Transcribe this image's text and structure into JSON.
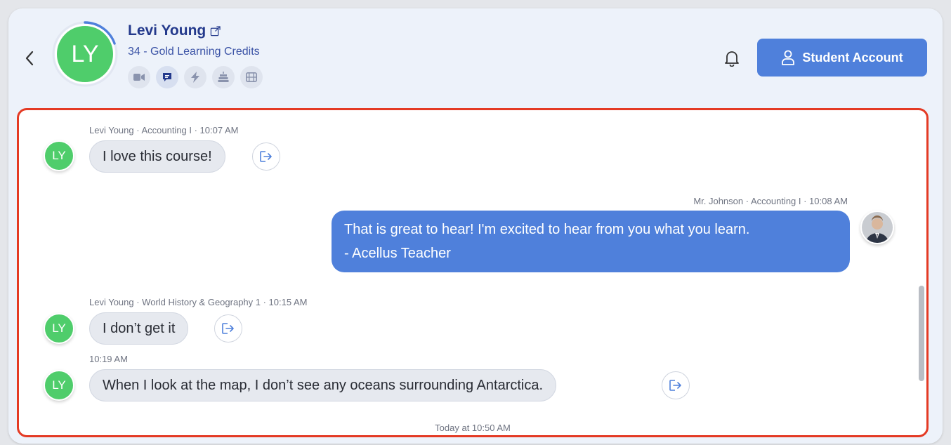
{
  "header": {
    "student_name": "Levi Young",
    "initials": "LY",
    "credits": "34 - Gold Learning Credits",
    "account_button_label": "Student Account",
    "mini_icons": [
      "video-icon",
      "chat-icon",
      "lightning-icon",
      "cake-icon",
      "film-icon"
    ]
  },
  "messages": [
    {
      "meta": "Levi Young · Accounting I · 10:07 AM",
      "initials": "LY",
      "text": "I love this course!"
    },
    {
      "meta": "Mr. Johnson · Accounting I · 10:08 AM",
      "line1": "That is great to hear! I'm excited to hear from you what you learn.",
      "line2": "- Acellus Teacher"
    },
    {
      "meta": "Levi Young · World History & Geography 1 · 10:15 AM",
      "initials": "LY",
      "text": "I don’t get it"
    },
    {
      "meta": "10:19 AM",
      "initials": "LY",
      "text": "When I look at the map, I don’t see any oceans surrounding Antarctica."
    }
  ],
  "footer_time": "Today at 10:50 AM",
  "colors": {
    "accent": "#4f80db",
    "avatar_green": "#4fcd6b",
    "name_blue": "#23398c",
    "highlight_border": "#e43a24"
  }
}
